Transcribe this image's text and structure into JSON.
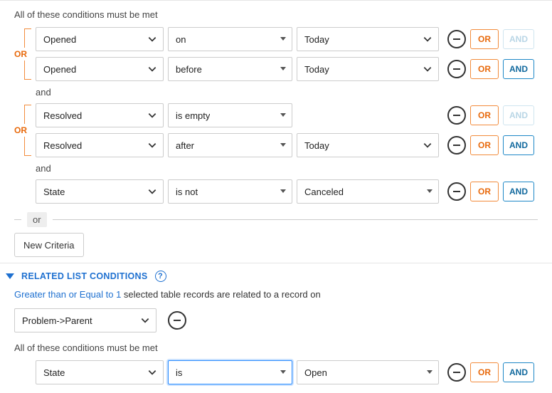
{
  "labels": {
    "conditions_heading": "All of these conditions must be met",
    "and_word": "and",
    "or_word": "OR",
    "or_chip": "or",
    "or_pill": "OR",
    "and_pill": "AND",
    "new_criteria": "New Criteria",
    "related_header": "RELATED LIST CONDITIONS",
    "help": "?"
  },
  "filter": {
    "groups": [
      {
        "rows": [
          {
            "field": "Opened",
            "operator": "on",
            "value": "Today",
            "and_enabled": false,
            "value_chev": "heavy"
          },
          {
            "field": "Opened",
            "operator": "before",
            "value": "Today",
            "and_enabled": true,
            "value_chev": "heavy"
          }
        ]
      },
      {
        "rows": [
          {
            "field": "Resolved",
            "operator": "is empty",
            "value": null,
            "and_enabled": false,
            "value_chev": null
          },
          {
            "field": "Resolved",
            "operator": "after",
            "value": "Today",
            "and_enabled": true,
            "value_chev": "heavy"
          }
        ]
      },
      {
        "rows": [
          {
            "field": "State",
            "operator": "is not",
            "value": "Canceled",
            "and_enabled": true,
            "value_chev": "thin"
          }
        ]
      }
    ]
  },
  "related": {
    "prefix_link": "Greater than or Equal to 1",
    "prefix_rest": " selected table records are related to a record on",
    "table": "Problem->Parent",
    "conditions_heading": "All of these conditions must be met",
    "rows": [
      {
        "field": "State",
        "operator": "is",
        "value": "Open",
        "and_enabled": true,
        "op_focused": true
      }
    ]
  }
}
